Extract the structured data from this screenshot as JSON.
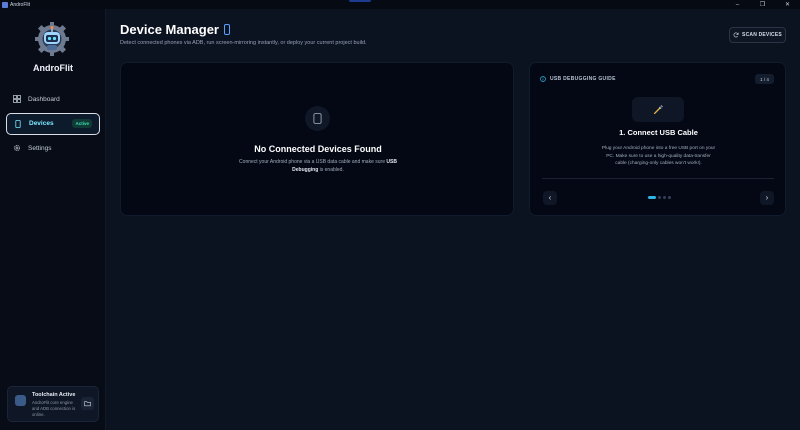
{
  "window": {
    "title": "AndroFlit",
    "controls": [
      "–",
      "❐",
      "✕"
    ]
  },
  "sidebar": {
    "brand": "AndroFlit",
    "items": [
      {
        "label": "Dashboard",
        "icon": "grid-icon"
      },
      {
        "label": "Devices",
        "icon": "phone-icon",
        "badge": "Active"
      },
      {
        "label": "Settings",
        "icon": "gear-icon"
      }
    ],
    "toolchain": {
      "title": "Toolchain Active",
      "desc": "AndroFlit core engine and ADB connection is online."
    }
  },
  "header": {
    "title": "Device Manager",
    "subtitle": "Detect connected phones via ADB, run screen-mirroring instantly, or deploy your current project build.",
    "scan_label": "SCAN DEVICES"
  },
  "empty_state": {
    "title": "No Connected Devices Found",
    "desc_prefix": "Connect your Android phone via a USB data cable and make sure ",
    "desc_bold": "USB Debugging",
    "desc_suffix": " is enabled."
  },
  "guide": {
    "heading": "USB DEBUGGING GUIDE",
    "counter": "1 / 4",
    "step_title": "1. Connect USB Cable",
    "step_desc": "Plug your Android phone into a free USB port on your PC. Make sure to use a high-quality data-transfer cable (charging-only cables won't work!).",
    "prev": "‹",
    "next": "›",
    "total_steps": 4,
    "current_step": 1
  },
  "colors": {
    "accent": "#2fb4e6",
    "active_badge": "#3fe0b0",
    "background": "#0b1220"
  }
}
